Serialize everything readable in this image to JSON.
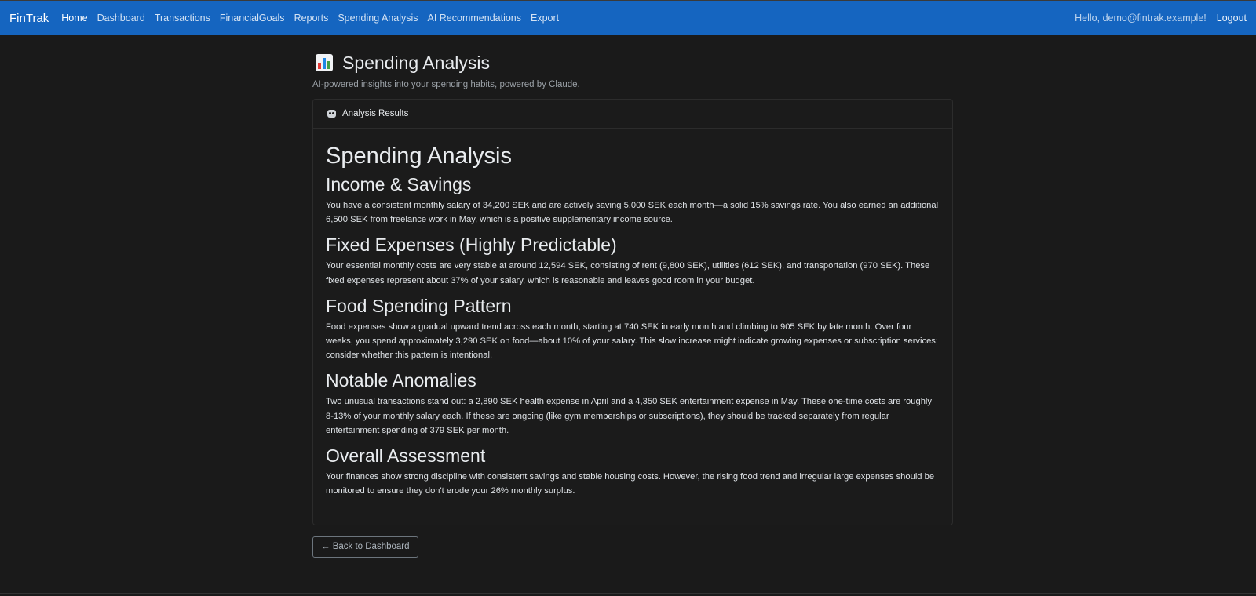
{
  "navbar": {
    "brand": "FinTrak",
    "links": [
      "Home",
      "Dashboard",
      "Transactions",
      "FinancialGoals",
      "Reports",
      "Spending Analysis",
      "AI Recommendations",
      "Export"
    ],
    "greeting": "Hello, demo@fintrak.example!",
    "logout": "Logout"
  },
  "page": {
    "title": "Spending Analysis",
    "subtitle": "AI-powered insights into your spending habits, powered by Claude."
  },
  "card": {
    "header": "Analysis Results",
    "title": "Spending Analysis",
    "sections": [
      {
        "heading": "Income & Savings",
        "text": "You have a consistent monthly salary of 34,200 SEK and are actively saving 5,000 SEK each month—a solid 15% savings rate. You also earned an additional 6,500 SEK from freelance work in May, which is a positive supplementary income source."
      },
      {
        "heading": "Fixed Expenses (Highly Predictable)",
        "text": "Your essential monthly costs are very stable at around 12,594 SEK, consisting of rent (9,800 SEK), utilities (612 SEK), and transportation (970 SEK). These fixed expenses represent about 37% of your salary, which is reasonable and leaves good room in your budget."
      },
      {
        "heading": "Food Spending Pattern",
        "text": "Food expenses show a gradual upward trend across each month, starting at 740 SEK in early month and climbing to 905 SEK by late month. Over four weeks, you spend approximately 3,290 SEK on food—about 10% of your salary. This slow increase might indicate growing expenses or subscription services; consider whether this pattern is intentional."
      },
      {
        "heading": "Notable Anomalies",
        "text": "Two unusual transactions stand out: a 2,890 SEK health expense in April and a 4,350 SEK entertainment expense in May. These one-time costs are roughly 8-13% of your monthly salary each. If these are ongoing (like gym memberships or subscriptions), they should be tracked separately from regular entertainment spending of 379 SEK per month."
      },
      {
        "heading": "Overall Assessment",
        "text": "Your finances show strong discipline with consistent savings and stable housing costs. However, the rising food trend and irregular large expenses should be monitored to ensure they don't erode your 26% monthly surplus."
      }
    ]
  },
  "back_button": "← Back to Dashboard",
  "colors": {
    "navbar": "#1565c0",
    "background": "#1a1a1a"
  }
}
